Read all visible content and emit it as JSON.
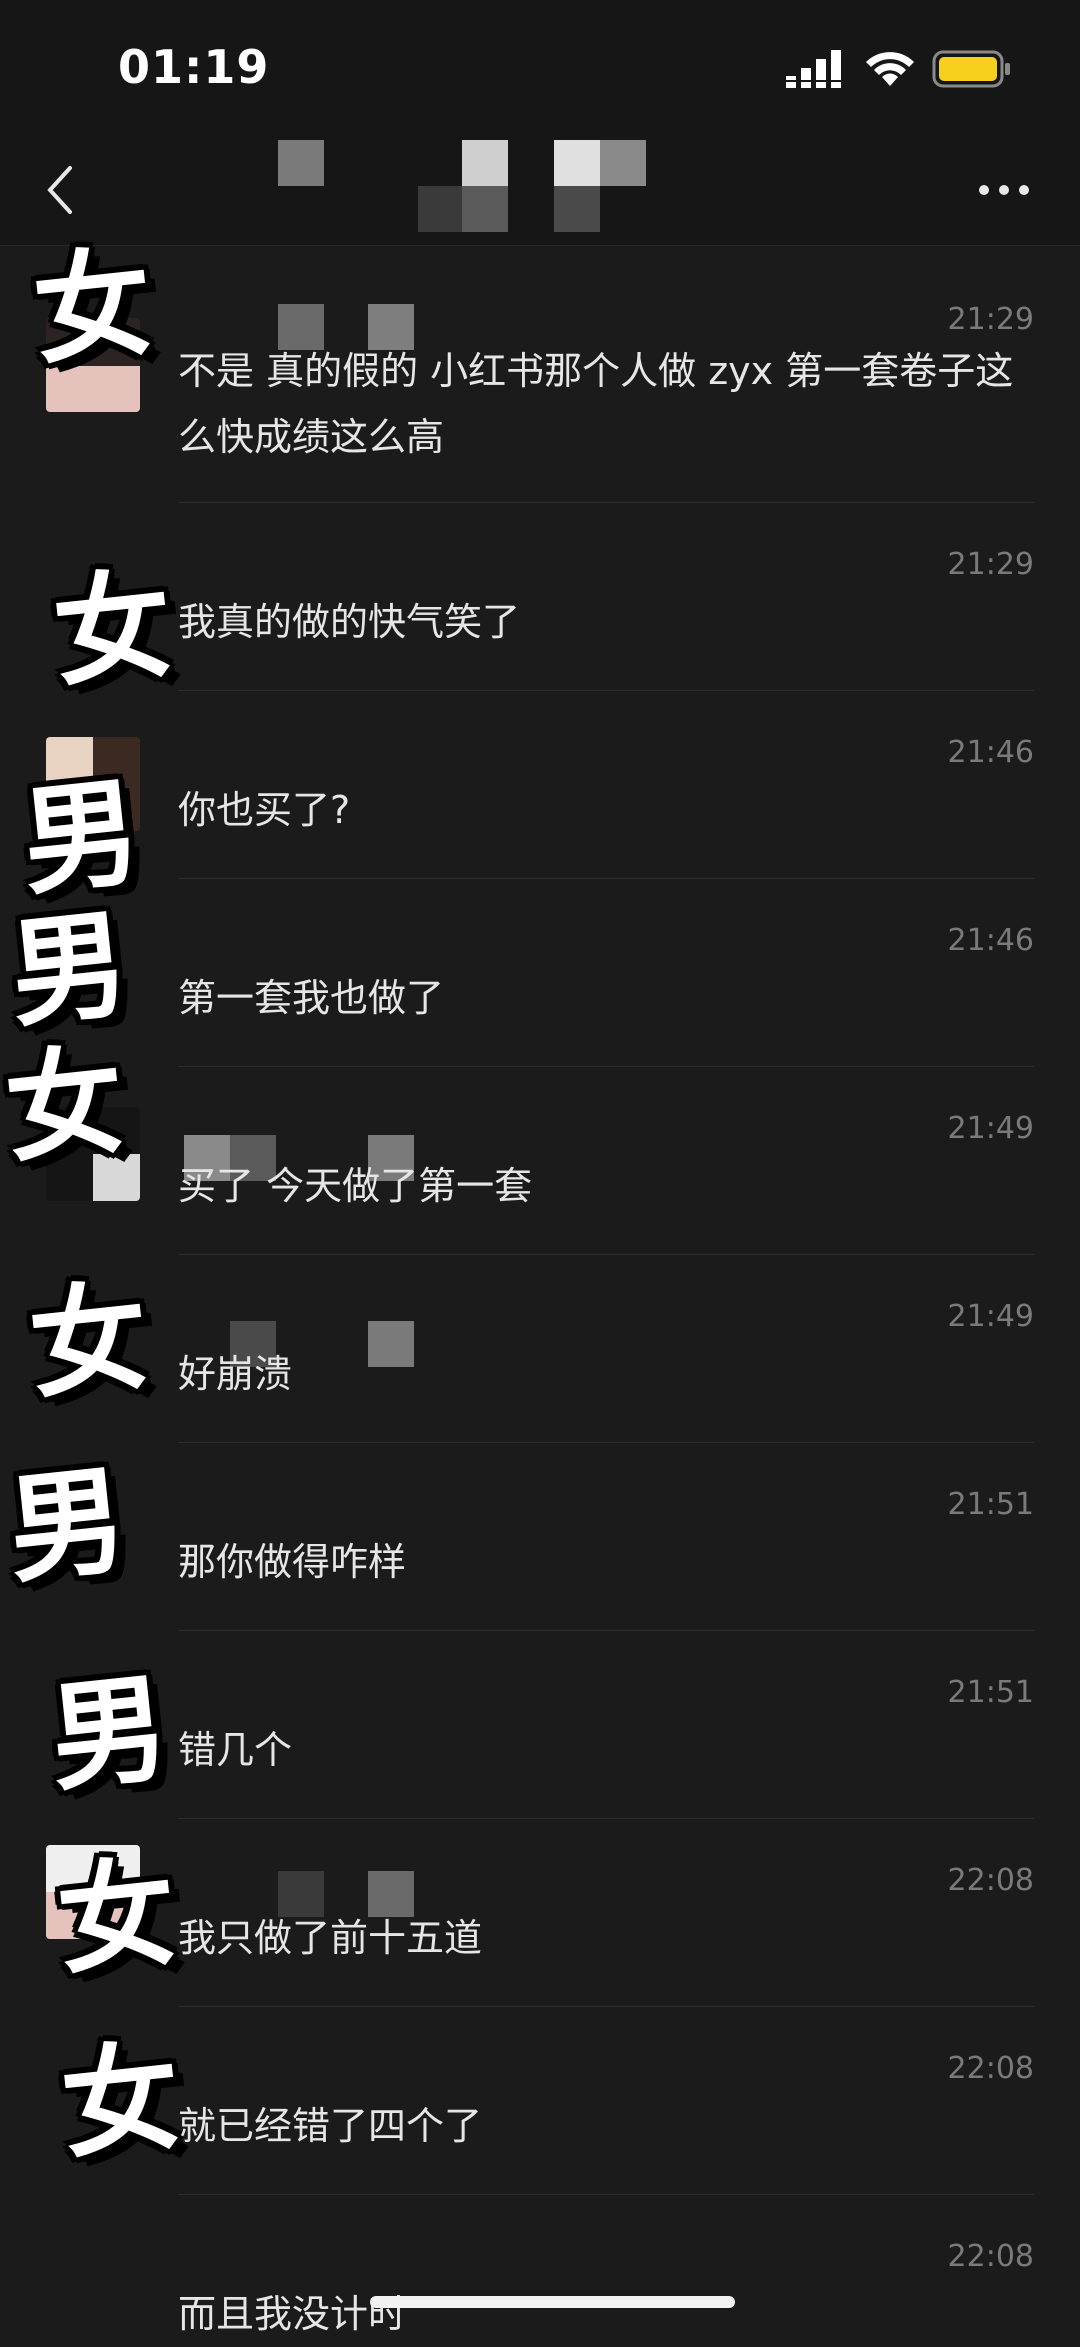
{
  "status": {
    "time": "01:19"
  },
  "colors": {
    "background": "#1b1b1b",
    "battery": "#f7cf1d",
    "timestamp": "#7a7a7a"
  },
  "messages": [
    {
      "time": "21:29",
      "text": "不是 真的假的 小红书那个人做 zyx 第一套卷子这么快成绩这么高"
    },
    {
      "time": "21:29",
      "text": "我真的做的快气笑了"
    },
    {
      "time": "21:46",
      "text": "你也买了?"
    },
    {
      "time": "21:46",
      "text": "第一套我也做了"
    },
    {
      "time": "21:49",
      "text": "买了 今天做了第一套"
    },
    {
      "time": "21:49",
      "text": "好崩溃"
    },
    {
      "time": "21:51",
      "text": "那你做得咋样"
    },
    {
      "time": "21:51",
      "text": "错几个"
    },
    {
      "time": "22:08",
      "text": "我只做了前十五道"
    },
    {
      "time": "22:08",
      "text": "就已经错了四个了"
    },
    {
      "time": "22:08",
      "text": "而且我没计时"
    }
  ],
  "tags": [
    "女",
    "女",
    "男",
    "男",
    "女",
    "女",
    "男",
    "男",
    "女",
    "女"
  ],
  "icons": {
    "back": "chevron-left-icon",
    "more": "more-dots-icon",
    "wifi": "wifi-icon",
    "signal": "signal-icon",
    "battery": "battery-icon"
  }
}
